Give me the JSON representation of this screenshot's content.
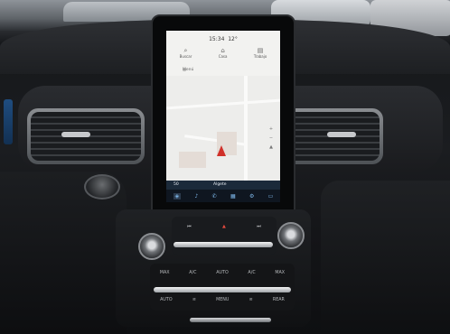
{
  "screen": {
    "time": "15:34",
    "temperature": "12°",
    "nav_items": [
      {
        "label": "Buscar",
        "icon": "search-icon"
      },
      {
        "label": "Casa",
        "icon": "home-icon"
      },
      {
        "label": "Trabajo",
        "icon": "briefcase-icon"
      }
    ],
    "menu_label": "Menú",
    "speed_limit": "50",
    "street_name": "Algete",
    "dock_items": [
      {
        "label": "Navegación",
        "icon": "navigation-icon"
      },
      {
        "label": "Audio",
        "icon": "music-icon"
      },
      {
        "label": "Teléfono",
        "icon": "phone-icon"
      },
      {
        "label": "Apps",
        "icon": "apps-icon"
      },
      {
        "label": "Ajustes",
        "icon": "settings-icon"
      },
      {
        "label": "Vehículo",
        "icon": "car-icon"
      }
    ]
  },
  "console": {
    "media_row": [
      "⏮",
      "▲",
      "⏭"
    ],
    "left_knob": "Volumen",
    "right_knob": "Sintonía",
    "climate_row1": [
      "MAX",
      "A/C",
      "AUTO",
      "A/C",
      "MAX"
    ],
    "climate_row2": [
      "AUTO",
      "≋",
      "MENU",
      "≋",
      "REAR"
    ]
  }
}
